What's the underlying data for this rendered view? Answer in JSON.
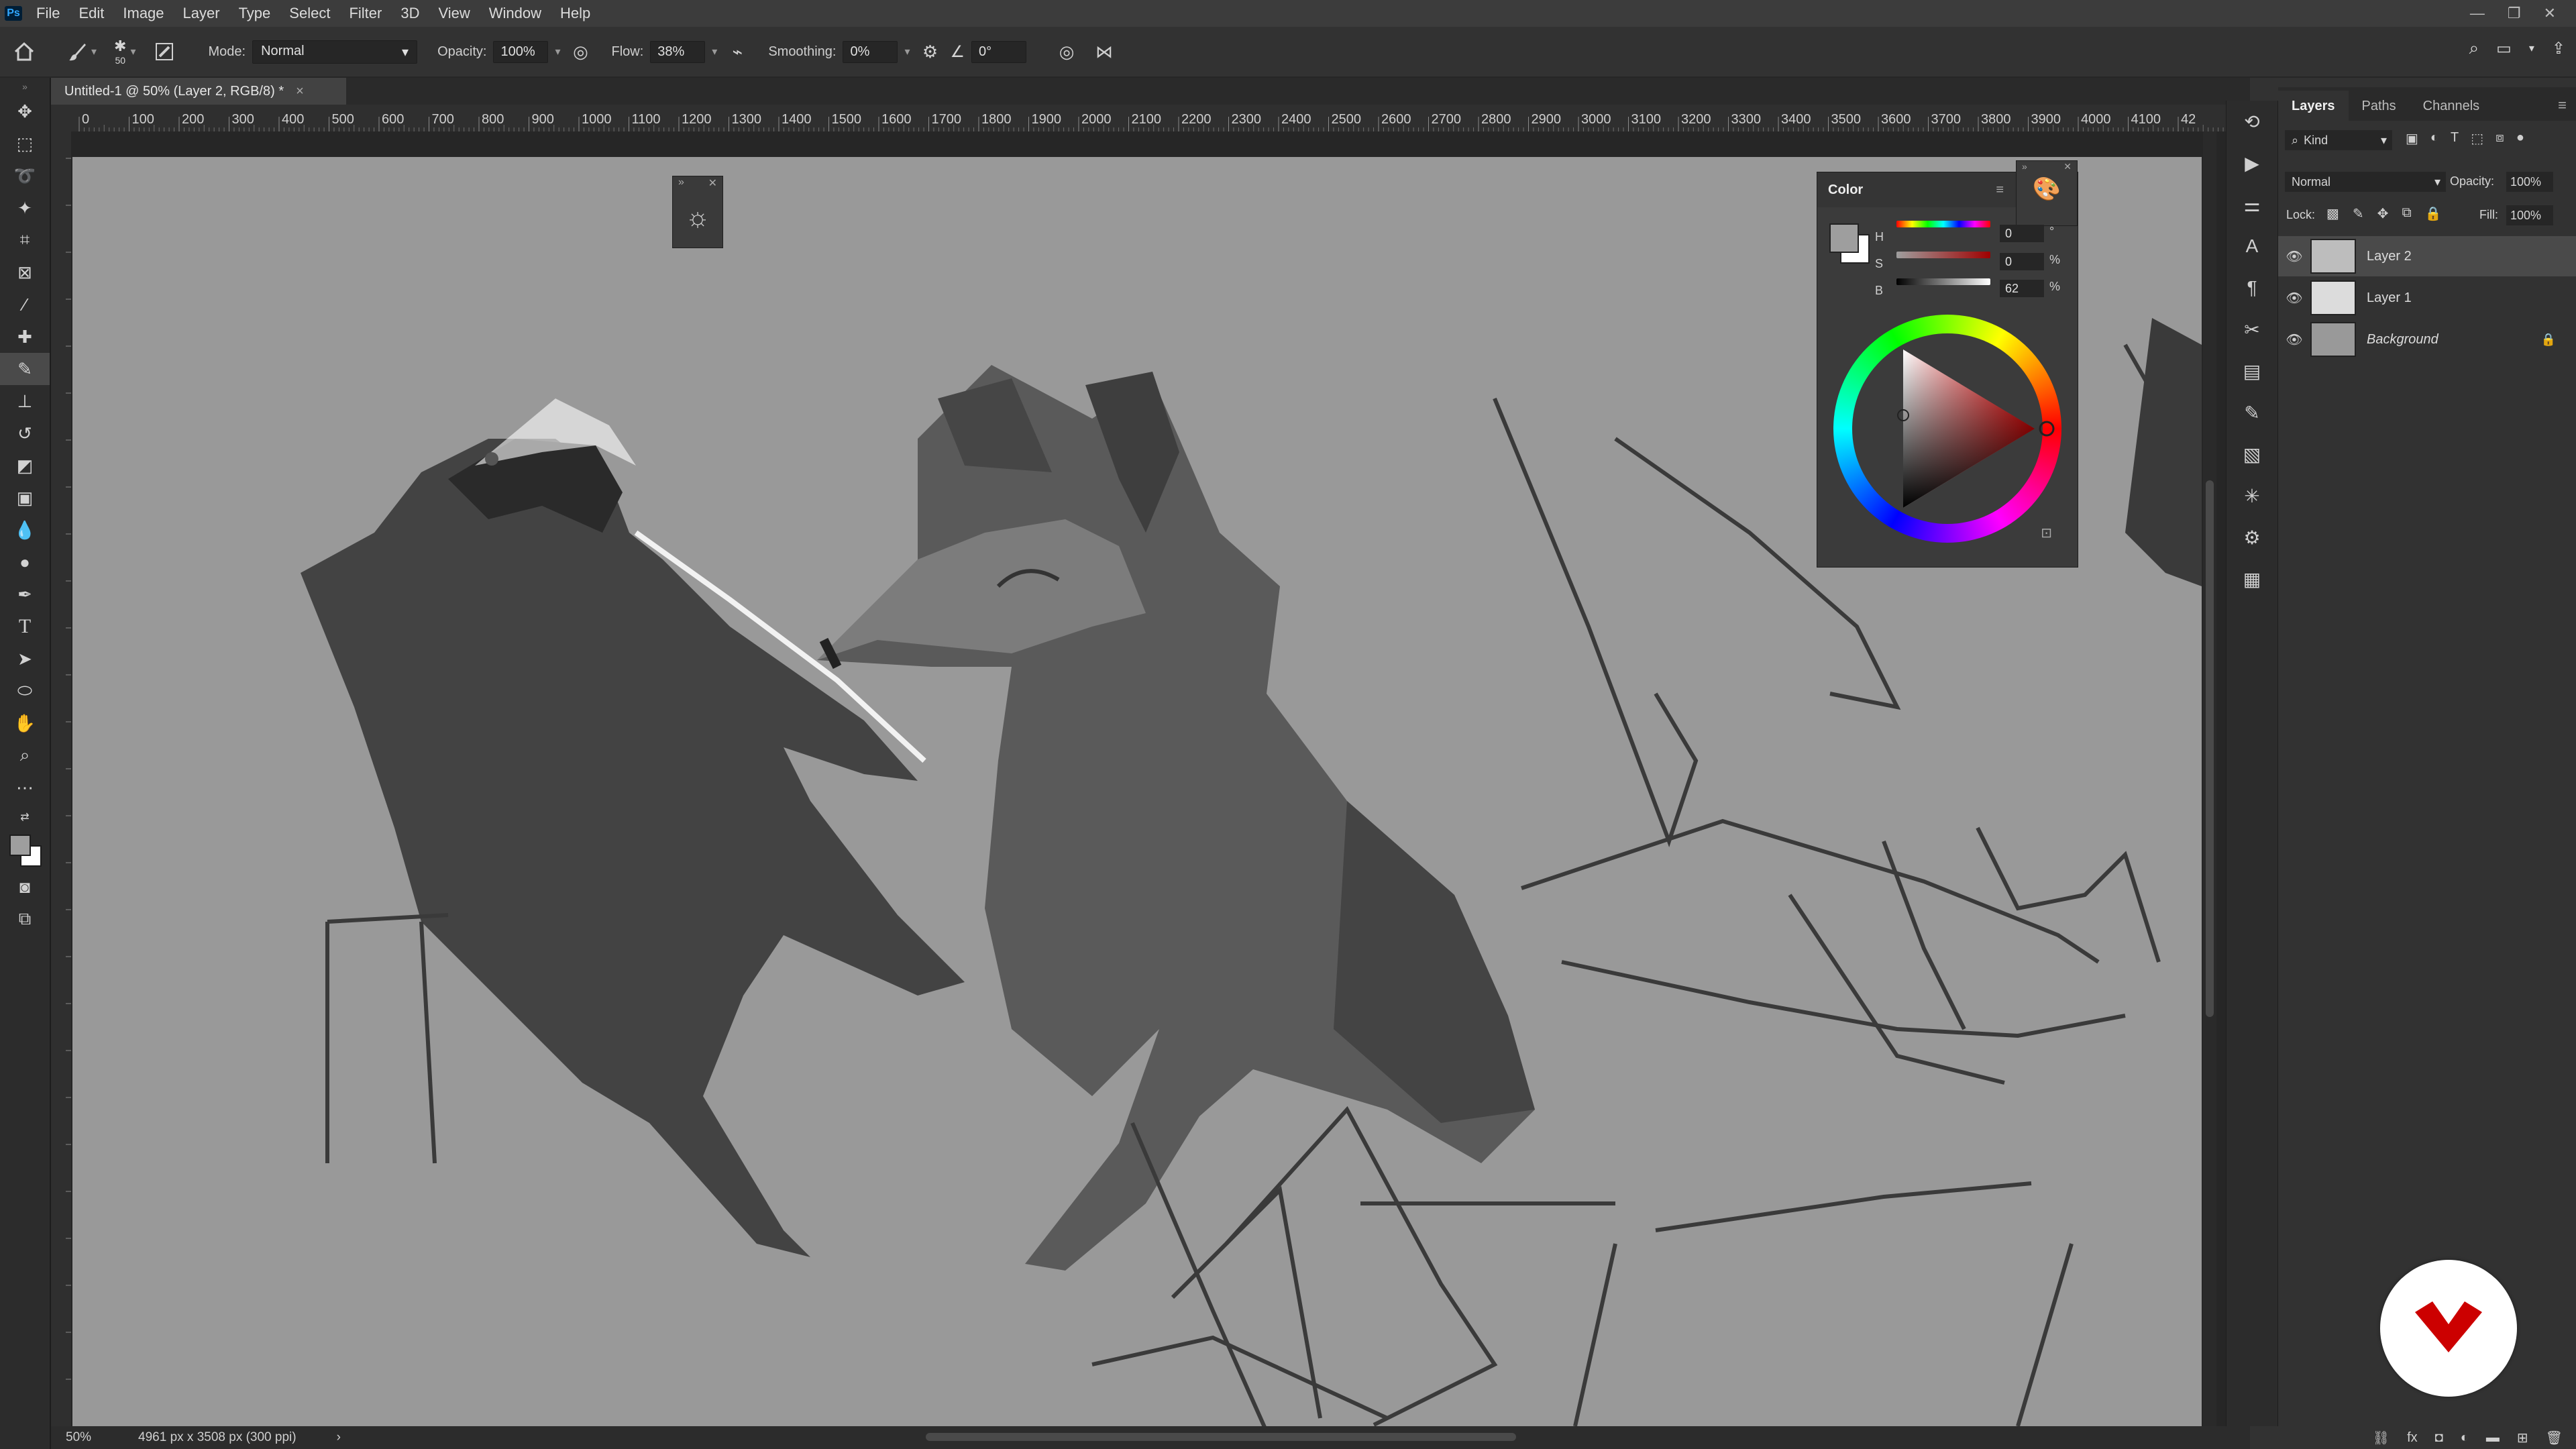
{
  "app": {
    "logo_text": "Ps"
  },
  "menu": [
    "File",
    "Edit",
    "Image",
    "Layer",
    "Type",
    "Select",
    "Filter",
    "3D",
    "View",
    "Window",
    "Help"
  ],
  "options_bar": {
    "brush_size": "50",
    "mode_label": "Mode:",
    "mode_value": "Normal",
    "opacity_label": "Opacity:",
    "opacity_value": "100%",
    "flow_label": "Flow:",
    "flow_value": "38%",
    "smoothing_label": "Smoothing:",
    "smoothing_value": "0%",
    "angle_value": "0°"
  },
  "document": {
    "tab_title": "Untitled-1 @ 50% (Layer 2, RGB/8) *",
    "close_glyph": "×"
  },
  "ruler": {
    "top_labels": [
      "0",
      "100",
      "200",
      "300",
      "400",
      "500",
      "600",
      "700",
      "800",
      "900",
      "1000",
      "1100",
      "1200",
      "1300",
      "1400",
      "1500",
      "1600",
      "1700",
      "1800",
      "1900",
      "2000",
      "2100",
      "2200",
      "2300",
      "2400",
      "2500",
      "2600",
      "2700",
      "2800",
      "2900",
      "3000",
      "3100",
      "3200",
      "3300",
      "3400",
      "3500",
      "3600",
      "3700",
      "3800",
      "3900",
      "4000",
      "4100",
      "42"
    ]
  },
  "status": {
    "zoom": "50%",
    "doc_info": "4961 px x 3508 px (300 ppi)",
    "arrow": "›"
  },
  "color_panel": {
    "title": "Color",
    "h_label": "H",
    "h_value": "0",
    "h_unit": "°",
    "s_label": "S",
    "s_value": "0",
    "s_unit": "%",
    "b_label": "B",
    "b_value": "62",
    "b_unit": "%",
    "foreground": "#9e9e9e",
    "background_swatch": "#ffffff"
  },
  "layers_panel": {
    "tabs": [
      "Layers",
      "Paths",
      "Channels"
    ],
    "kind_label": "Kind",
    "blend_mode": "Normal",
    "opacity_label": "Opacity:",
    "opacity_value": "100%",
    "lock_label": "Lock:",
    "fill_label": "Fill:",
    "fill_value": "100%",
    "layers": [
      {
        "name": "Layer 2",
        "selected": true
      },
      {
        "name": "Layer 1",
        "selected": false
      },
      {
        "name": "Background",
        "selected": false,
        "locked": true
      }
    ]
  },
  "colors": {
    "canvas": "#999999",
    "accent_logo": "#cc0000"
  }
}
